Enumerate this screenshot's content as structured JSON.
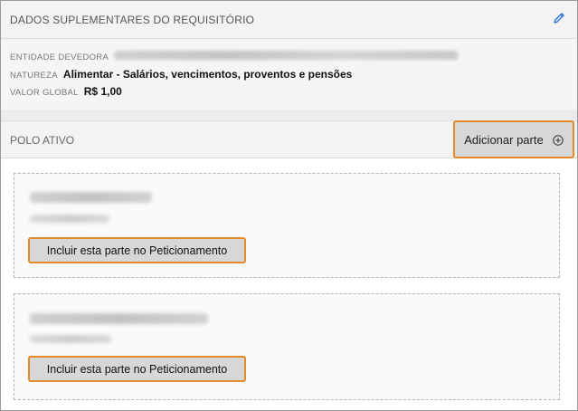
{
  "section": {
    "title": "DADOS SUPLEMENTARES DO REQUISITÓRIO",
    "edit_icon": "pencil-icon"
  },
  "info": {
    "entidade_label": "ENTIDADE DEVEDORA",
    "natureza_label": "NATUREZA",
    "natureza_value": "Alimentar - Salários, vencimentos, proventos e pensões",
    "valor_label": "VALOR GLOBAL",
    "valor_value": "R$ 1,00"
  },
  "polo": {
    "title": "POLO ATIVO",
    "add_label": "Adicionar parte",
    "add_icon": "plus-circle-icon"
  },
  "parties": [
    {
      "include_label": "Incluir esta parte no Peticionamento"
    },
    {
      "include_label": "Incluir esta parte no Peticionamento"
    }
  ],
  "colors": {
    "highlight": "#e38a2a",
    "button_bg": "#d7d7d7",
    "edit_icon": "#1e6fd9"
  }
}
